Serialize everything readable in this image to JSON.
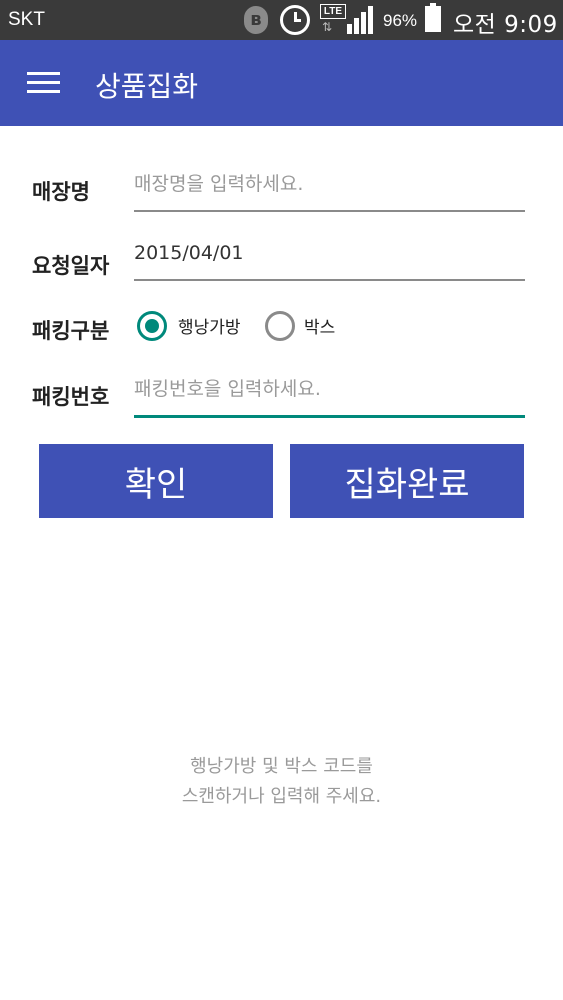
{
  "status_bar": {
    "carrier": "SKT",
    "battery_percent": "96%",
    "time": "오전 9:09",
    "network_type": "LTE",
    "icons": [
      "bluetooth-icon",
      "alarm-icon",
      "lte-icon",
      "signal-icon",
      "battery-icon"
    ]
  },
  "app_bar": {
    "title": "상품집화",
    "menu_icon": "hamburger-menu-icon"
  },
  "form": {
    "store": {
      "label": "매장명",
      "value": "",
      "placeholder": "매장명을 입력하세요."
    },
    "request_date": {
      "label": "요청일자",
      "value": "2015/04/01"
    },
    "packing_type": {
      "label": "패킹구분",
      "options": [
        {
          "label": "행낭가방",
          "selected": true
        },
        {
          "label": "박스",
          "selected": false
        }
      ]
    },
    "packing_number": {
      "label": "패킹번호",
      "value": "",
      "placeholder": "패킹번호을 입력하세요."
    }
  },
  "buttons": {
    "confirm": "확인",
    "complete": "집화완료"
  },
  "hint": {
    "line1": "행낭가방 및 박스 코드를",
    "line2": "스캔하거나 입력해 주세요."
  },
  "colors": {
    "status_bar": "#3a3a3a",
    "primary": "#3f51b5",
    "accent": "#00897b"
  }
}
